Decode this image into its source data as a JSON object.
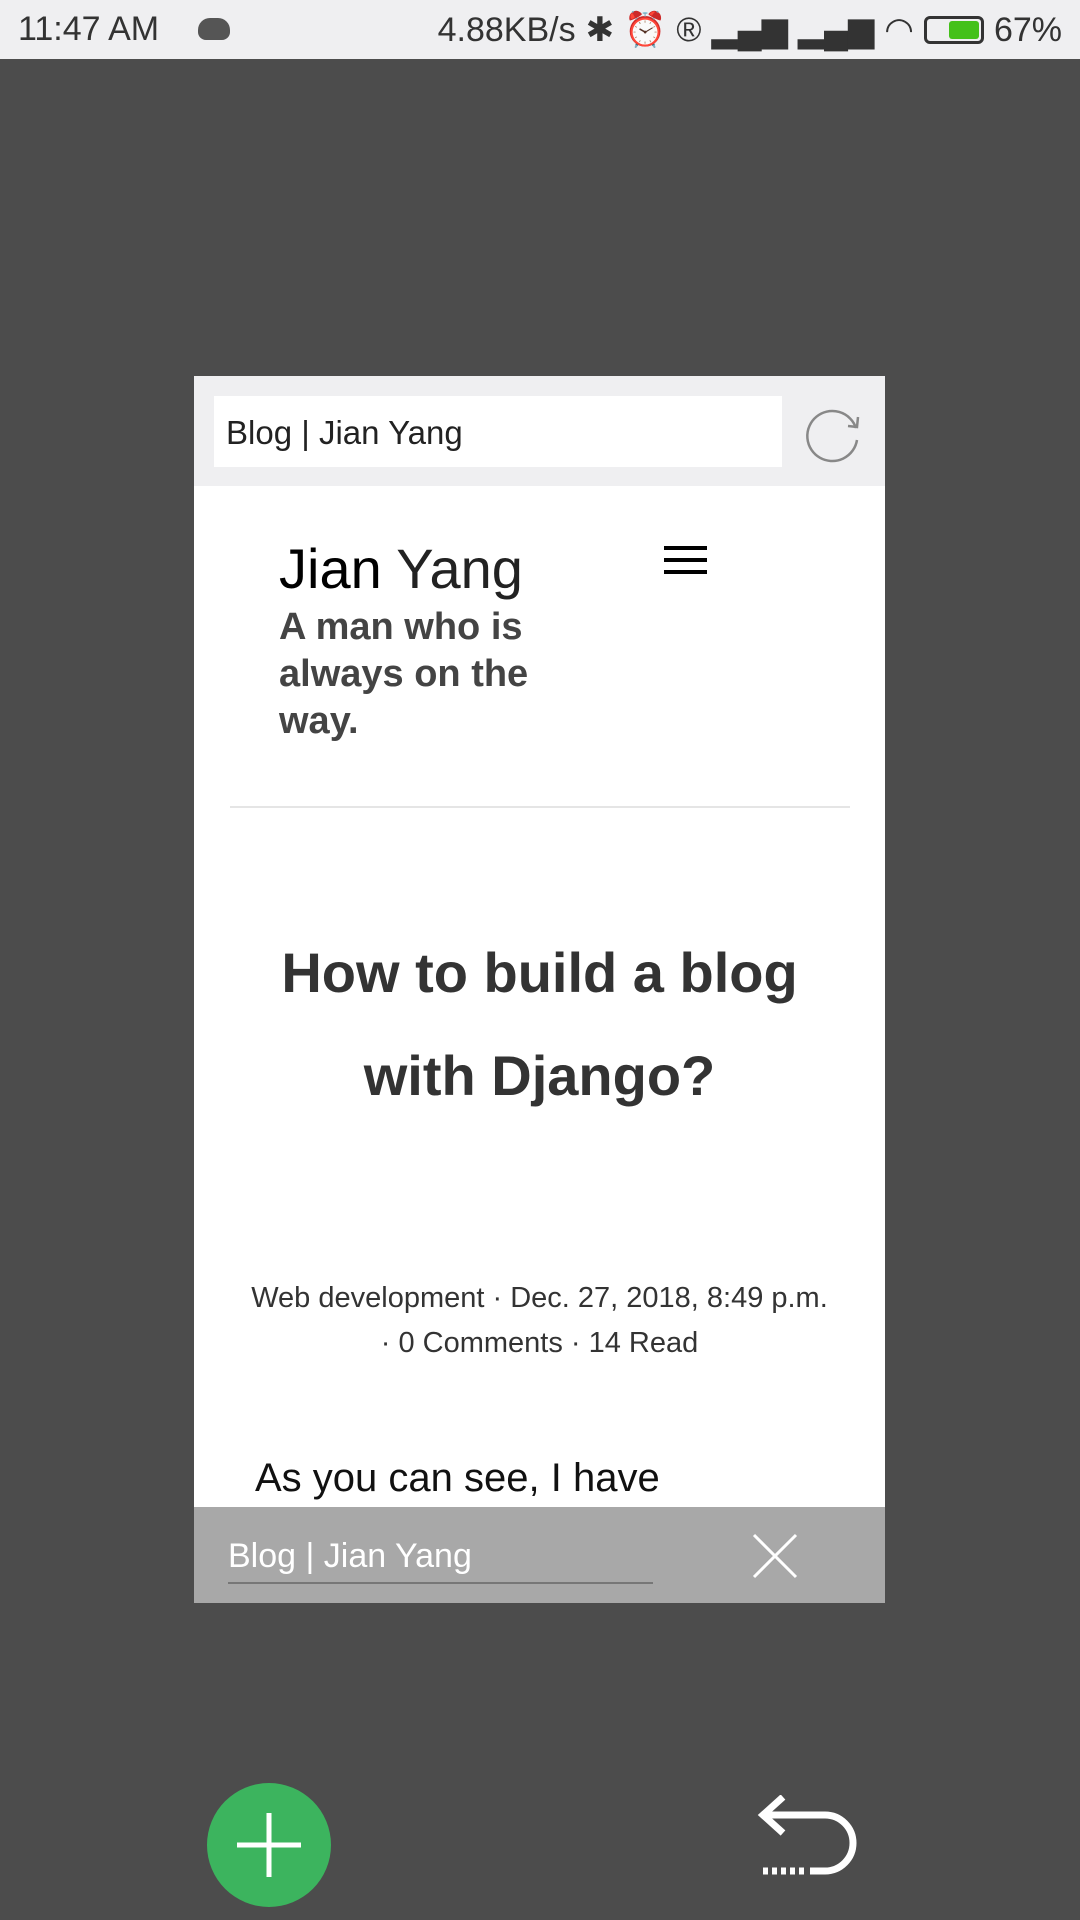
{
  "status_bar": {
    "time": "11:47 AM",
    "net_speed": "4.88KB/s",
    "battery": "67%"
  },
  "tab_card": {
    "url_bar": {
      "value": "Blog | Jian Yang"
    },
    "page": {
      "brand_first": "Jian",
      "brand_last": "Yang",
      "tagline": "A man who is always on the way.",
      "post_title": "How to build a blog with Django?",
      "meta": "Web development · Dec. 27, 2018, 8:49 p.m. · 0 Comments · 14 Read",
      "body_start": "As you can see, I have"
    },
    "tab_title": "Blog | Jian Yang"
  },
  "colors": {
    "fab": "#3cb45e",
    "background": "#4c4c4c",
    "tab_bar": "#a8a8a8"
  }
}
